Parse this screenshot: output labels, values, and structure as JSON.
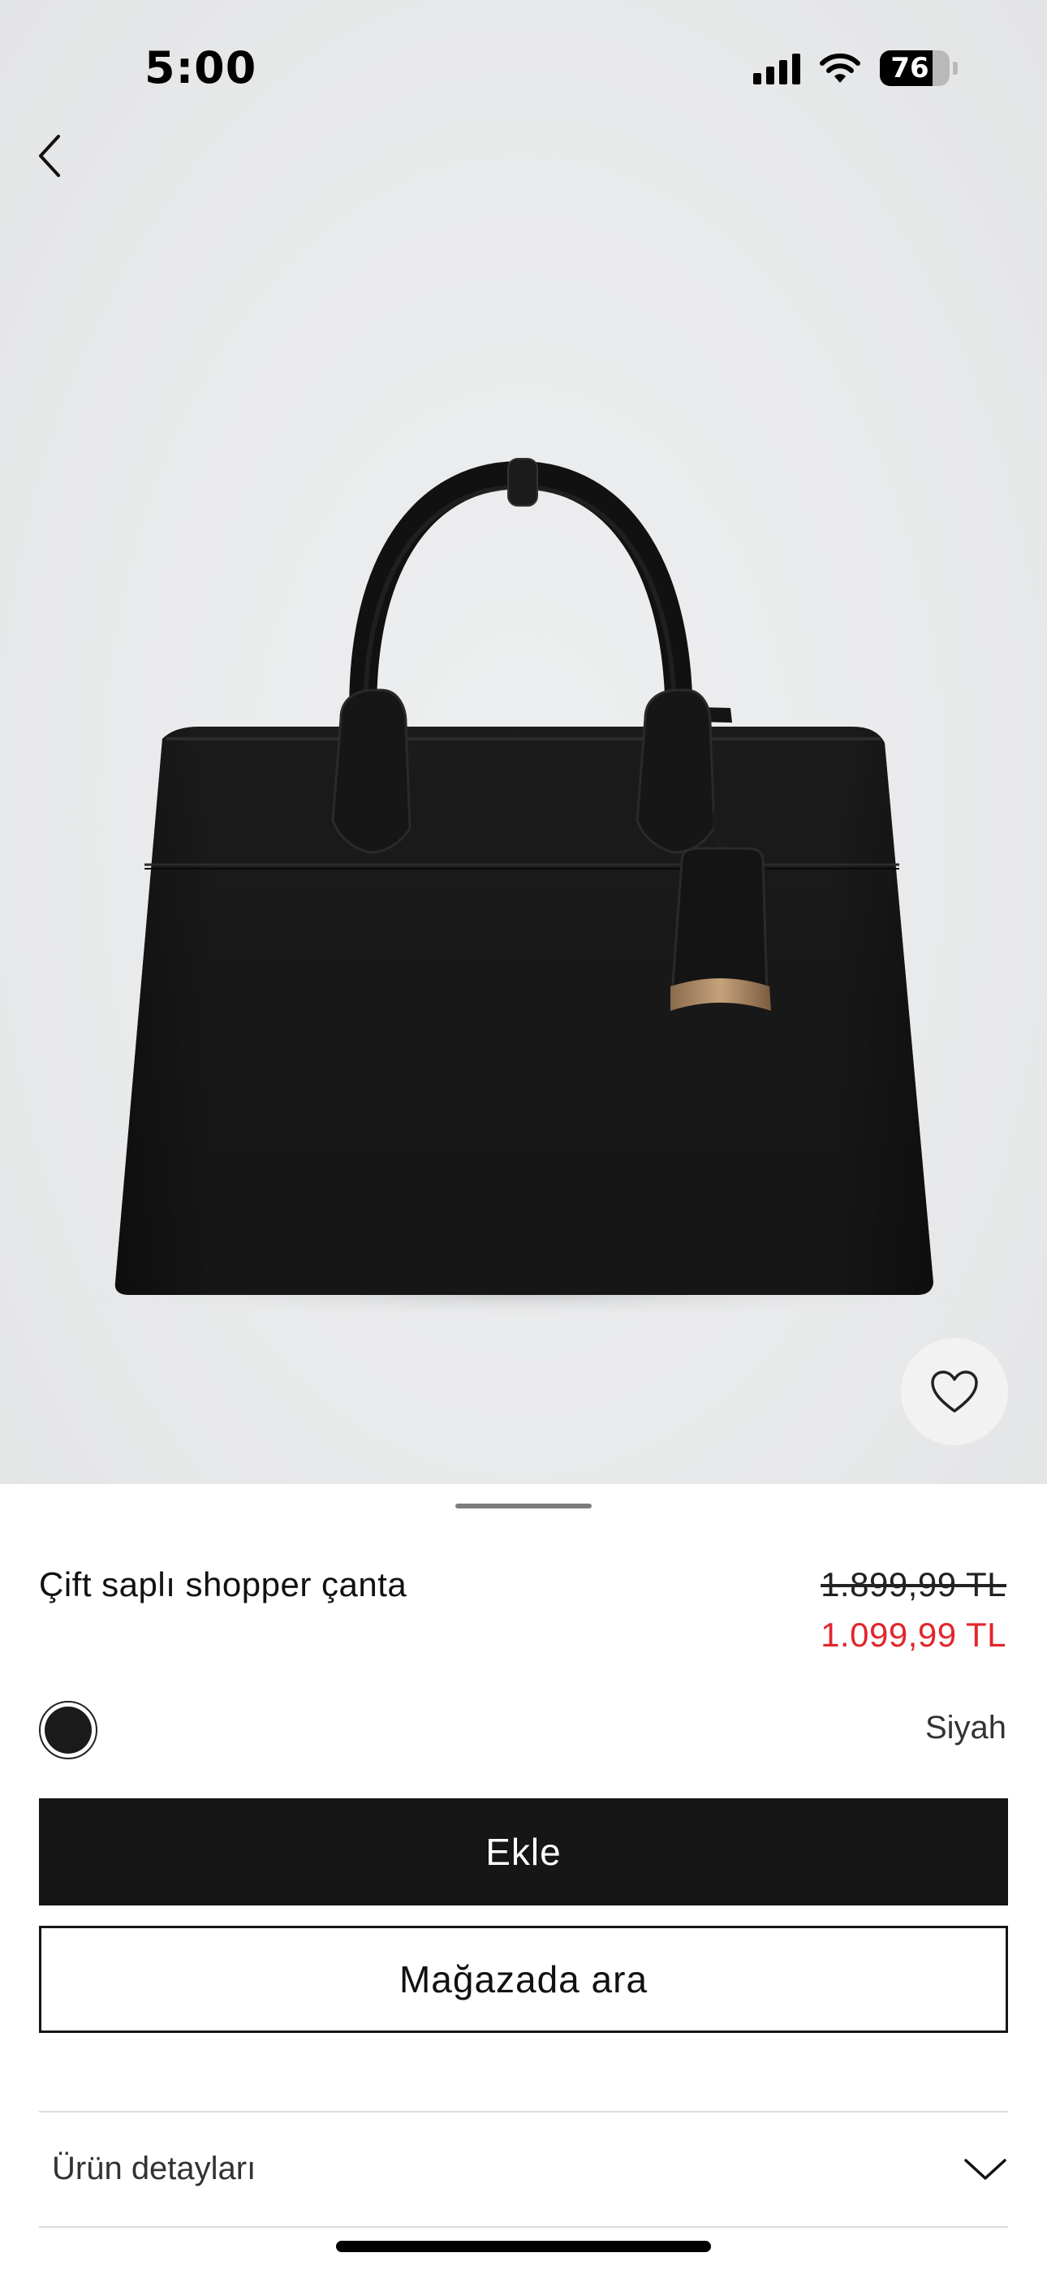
{
  "status_bar": {
    "time": "5:00",
    "battery_level": "76",
    "icons": [
      "cellular-signal-icon",
      "wifi-icon",
      "battery-icon"
    ]
  },
  "nav": {
    "back_icon": "chevron-left-icon"
  },
  "product": {
    "image_subject": "black leather tote handbag",
    "title": "Çift saplı shopper çanta",
    "price_old": "1.899,99 TL",
    "price_new": "1.099,99 TL",
    "color_name": "Siyah",
    "favorite_icon": "heart-outline-icon"
  },
  "actions": {
    "add_label": "Ekle",
    "store_label": "Mağazada ara"
  },
  "details": {
    "label": "Ürün detayları",
    "toggle_icon": "chevron-down-icon"
  },
  "colors": {
    "price_sale": "#e1262c",
    "primary_button": "#161616",
    "background": "#ffffff"
  }
}
